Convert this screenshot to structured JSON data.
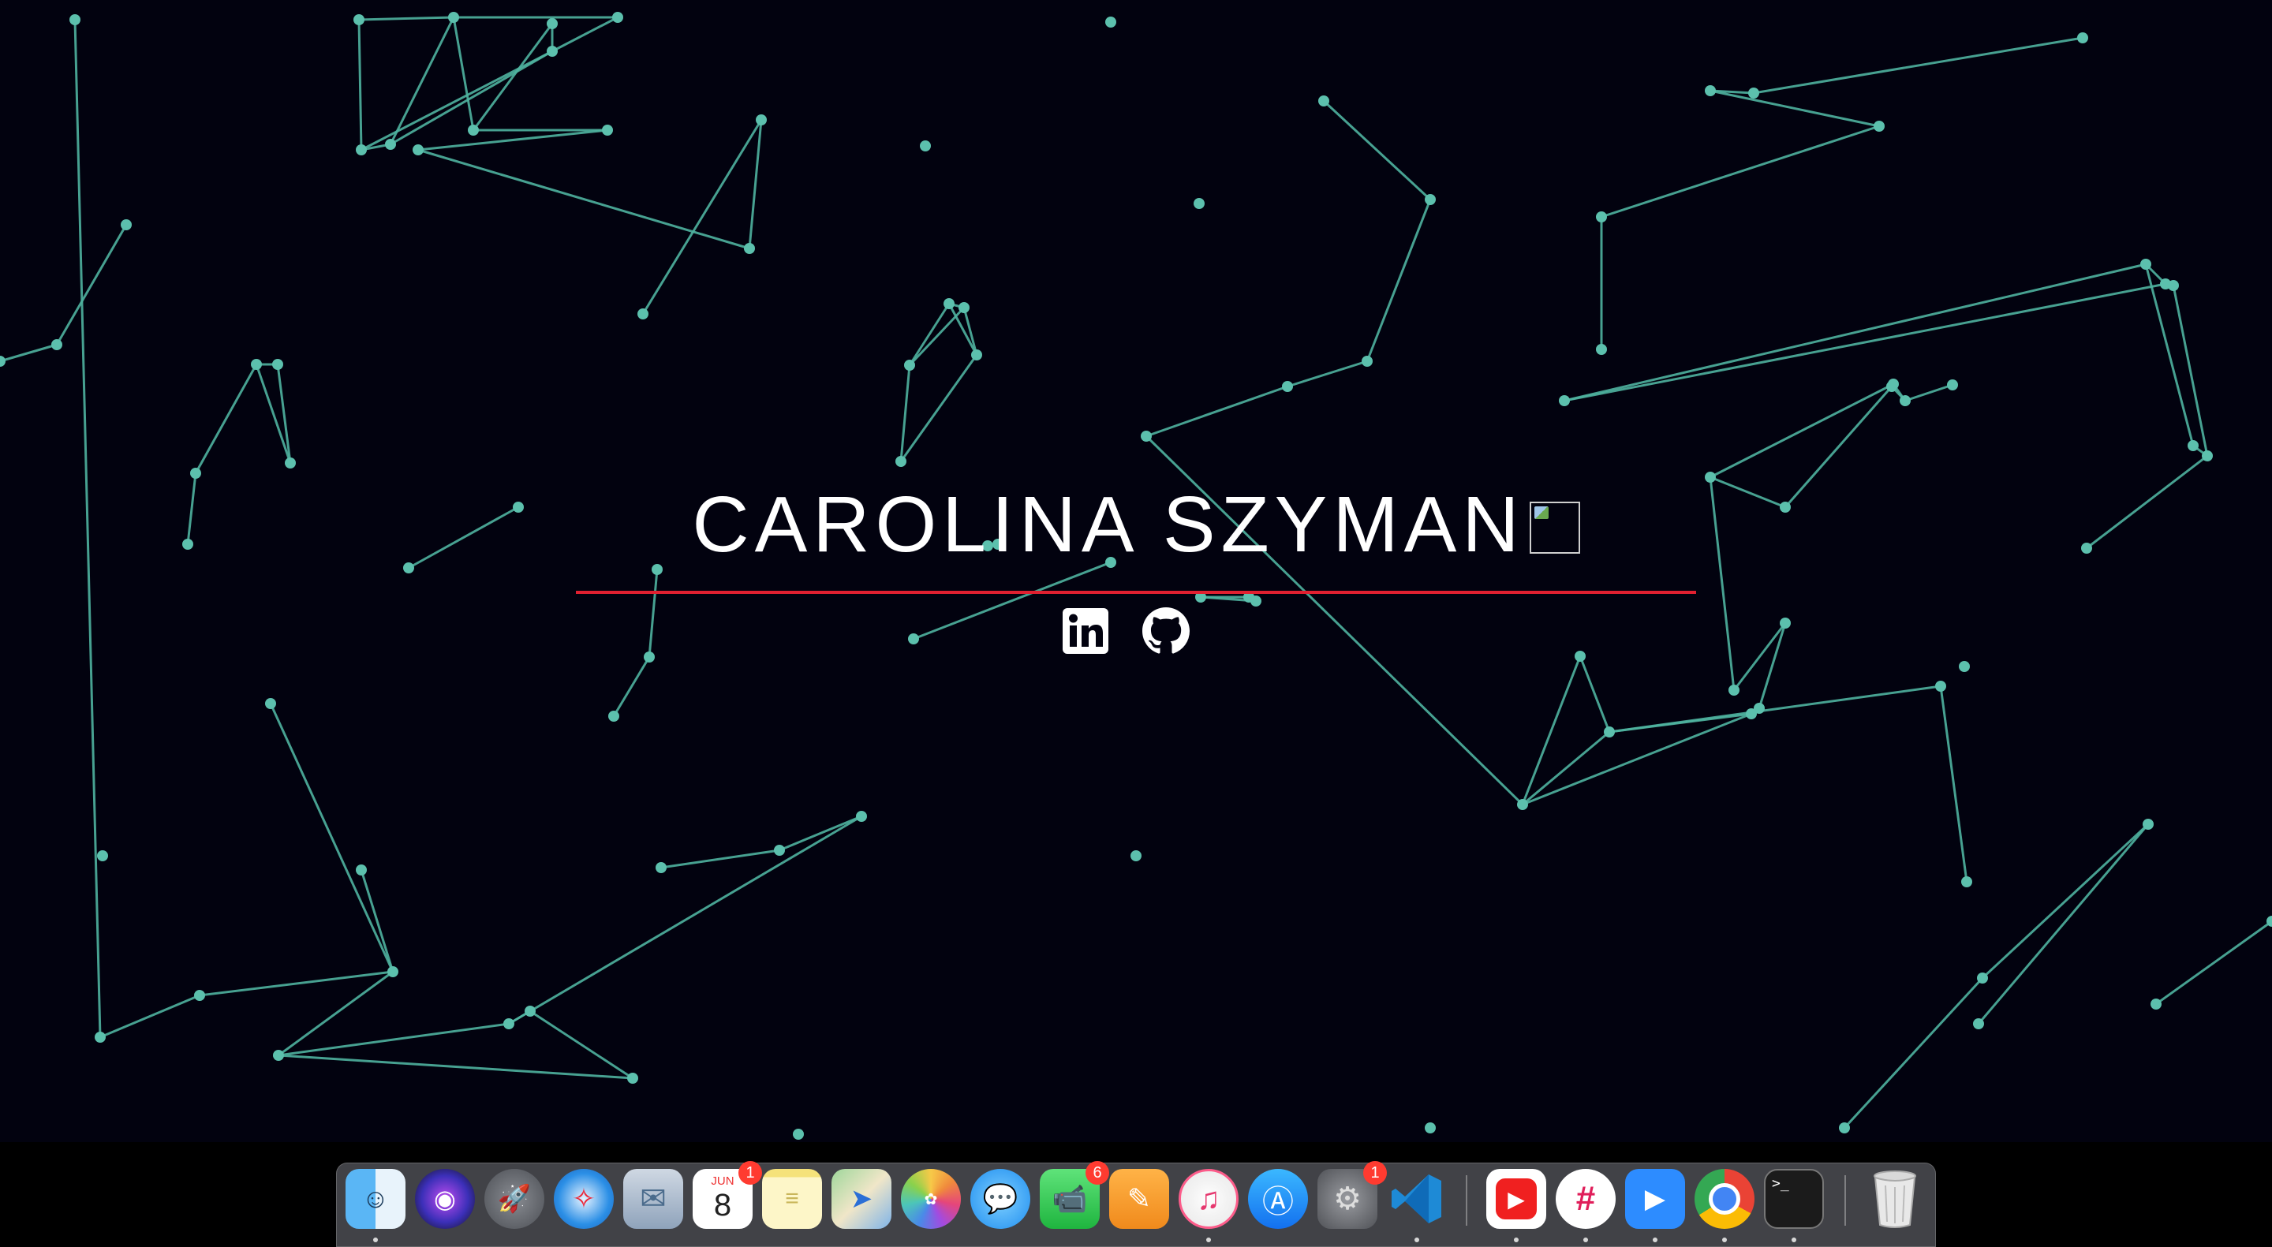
{
  "hero": {
    "name": "CAROLINA SZYMAN",
    "accent_color": "#e02030",
    "socials": [
      {
        "label": "LinkedIn",
        "icon": "linkedin-icon"
      },
      {
        "label": "GitHub",
        "icon": "github-icon"
      }
    ]
  },
  "background": {
    "color": "#02020f",
    "node_color": "#5cc0ad",
    "line_color": "#4fb3a0"
  },
  "dock": {
    "apps": [
      {
        "name": "Finder",
        "icon": "finder-icon",
        "running": true
      },
      {
        "name": "Siri",
        "icon": "siri-icon",
        "running": false
      },
      {
        "name": "Launchpad",
        "icon": "launchpad-icon",
        "running": false
      },
      {
        "name": "Safari",
        "icon": "safari-icon",
        "running": false
      },
      {
        "name": "Mail",
        "icon": "mail-icon",
        "running": false
      },
      {
        "name": "Calendar",
        "icon": "calendar-icon",
        "running": false,
        "badge": "1",
        "month": "JUN",
        "day": "8"
      },
      {
        "name": "Notes",
        "icon": "notes-icon",
        "running": false
      },
      {
        "name": "Maps",
        "icon": "maps-icon",
        "running": false
      },
      {
        "name": "Photos",
        "icon": "photos-icon",
        "running": false
      },
      {
        "name": "Messages",
        "icon": "messages-icon",
        "running": false
      },
      {
        "name": "FaceTime",
        "icon": "facetime-icon",
        "running": false,
        "badge": "6"
      },
      {
        "name": "Pages",
        "icon": "pages-icon",
        "running": false
      },
      {
        "name": "iTunes",
        "icon": "itunes-icon",
        "running": true
      },
      {
        "name": "App Store",
        "icon": "app-store-icon",
        "running": false
      },
      {
        "name": "System Preferences",
        "icon": "system-preferences-icon",
        "running": false,
        "badge": "1"
      },
      {
        "name": "Visual Studio Code",
        "icon": "vscode-icon",
        "running": true
      },
      {
        "name": "YouTube",
        "icon": "youtube-icon",
        "running": true
      },
      {
        "name": "Slack",
        "icon": "slack-icon",
        "running": true
      },
      {
        "name": "Zoom",
        "icon": "zoom-icon",
        "running": true
      },
      {
        "name": "Chrome",
        "icon": "chrome-icon",
        "running": true
      },
      {
        "name": "Terminal",
        "icon": "terminal-icon",
        "running": true
      },
      {
        "name": "Trash",
        "icon": "trash-icon",
        "running": false
      }
    ]
  }
}
